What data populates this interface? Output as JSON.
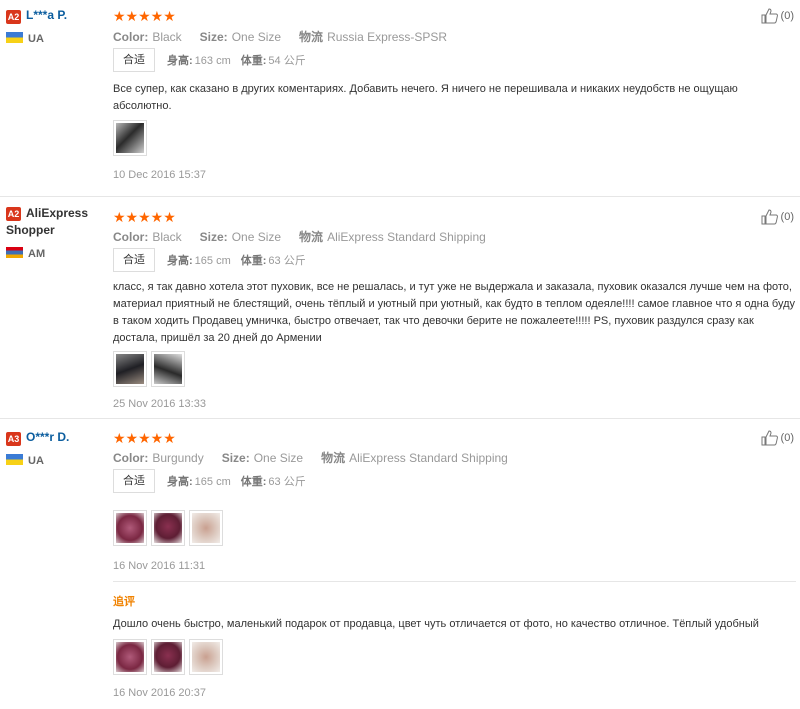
{
  "reviews": [
    {
      "level": "A2",
      "name": "L***a P.",
      "country": "UA",
      "stars": "★★★★★",
      "color_label": "Color:",
      "color_value": "Black",
      "size_label": "Size:",
      "size_value": "One Size",
      "ship_label": "物流",
      "ship_value": "Russia Express-SPSR",
      "fit": "合适",
      "height_label": "身高:",
      "height_value": "163 cm",
      "weight_label": "体重:",
      "weight_value": "54 公斤",
      "text": "Все супер, как сказано в других коментариях. Добавить нечего. Я ничего не перешивала и никаких неудобств не ощущаю абсолютно.",
      "date": "10 Dec 2016 15:37",
      "likes": "(0)"
    },
    {
      "level": "A2",
      "name": "AliExpress Shopper",
      "country": "AM",
      "stars": "★★★★★",
      "color_label": "Color:",
      "color_value": "Black",
      "size_label": "Size:",
      "size_value": "One Size",
      "ship_label": "物流",
      "ship_value": "AliExpress Standard Shipping",
      "fit": "合适",
      "height_label": "身高:",
      "height_value": "165 cm",
      "weight_label": "体重:",
      "weight_value": "63 公斤",
      "text": "класс, я так давно хотела этот пуховик, все не решалась, и тут уже не выдержала и заказала, пуховик оказался лучше чем на фото, материал приятный не блестящий, очень тёплый и уютный при уютный, как будто в теплом одеяле!!!! самое главное что я одна буду в таком ходить Продавец умничка, быстро отвечает, так что девочки берите не пожалеете!!!!! PS, пуховик раздулся сразу как достала, пришёл за 20 дней до Армении",
      "date": "25 Nov 2016 13:33",
      "likes": "(0)"
    },
    {
      "level": "A3",
      "name": "O***r D.",
      "country": "UA",
      "stars": "★★★★★",
      "color_label": "Color:",
      "color_value": "Burgundy",
      "size_label": "Size:",
      "size_value": "One Size",
      "ship_label": "物流",
      "ship_value": "AliExpress Standard Shipping",
      "fit": "合适",
      "height_label": "身高:",
      "height_value": "165 cm",
      "weight_label": "体重:",
      "weight_value": "63 公斤",
      "date": "16 Nov 2016 11:31",
      "likes": "(0)",
      "additional_label": "追评",
      "additional_text": "Дошло очень быстро, маленький подарок от продавца, цвет чуть отличается от фото, но качество отличное. Тёплый удобный",
      "additional_date": "16 Nov 2016 20:37"
    }
  ],
  "colors": {
    "accent_star": "#ff6600",
    "name_link": "#0b5d9e",
    "level_badge": "#d9361b",
    "followup": "#f08200"
  }
}
